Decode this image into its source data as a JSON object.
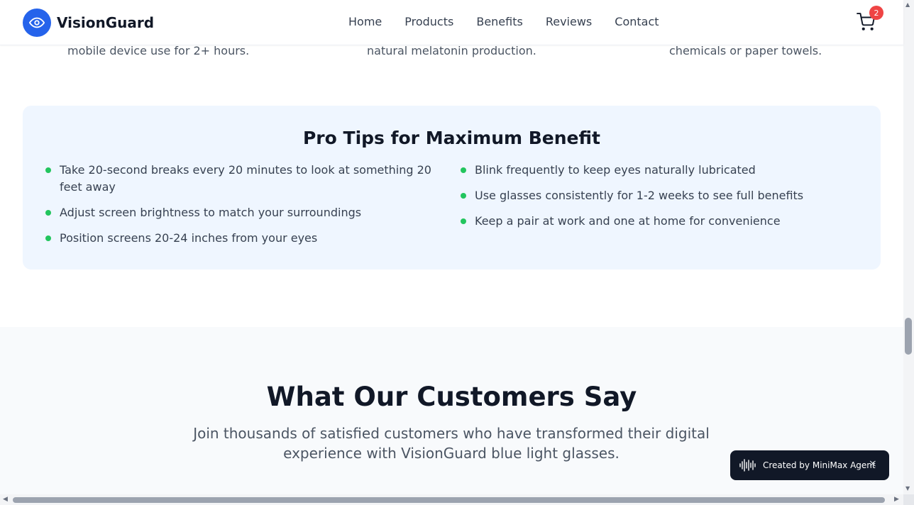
{
  "header": {
    "brand": "VisionGuard",
    "nav": [
      "Home",
      "Products",
      "Benefits",
      "Reviews",
      "Contact"
    ],
    "cart_count": "2",
    "accent": "#2563eb"
  },
  "partial_row": [
    "mobile device use for 2+ hours.",
    "natural melatonin production.",
    "chemicals or paper towels."
  ],
  "tips": {
    "title": "Pro Tips for Maximum Benefit",
    "left": [
      "Take 20-second breaks every 20 minutes to look at something 20 feet away",
      "Adjust screen brightness to match your surroundings",
      "Position screens 20-24 inches from your eyes"
    ],
    "right": [
      "Blink frequently to keep eyes naturally lubricated",
      "Use glasses consistently for 1-2 weeks to see full benefits",
      "Keep a pair at work and one at home for convenience"
    ],
    "bullet_color": "#22c55e"
  },
  "testimonials": {
    "title": "What Our Customers Say",
    "subtitle": "Join thousands of satisfied customers who have transformed their digital experience with VisionGuard blue light glasses."
  },
  "badge": {
    "text": "Created by MiniMax Agent",
    "close": "×",
    "icon": "soundwave-icon"
  }
}
